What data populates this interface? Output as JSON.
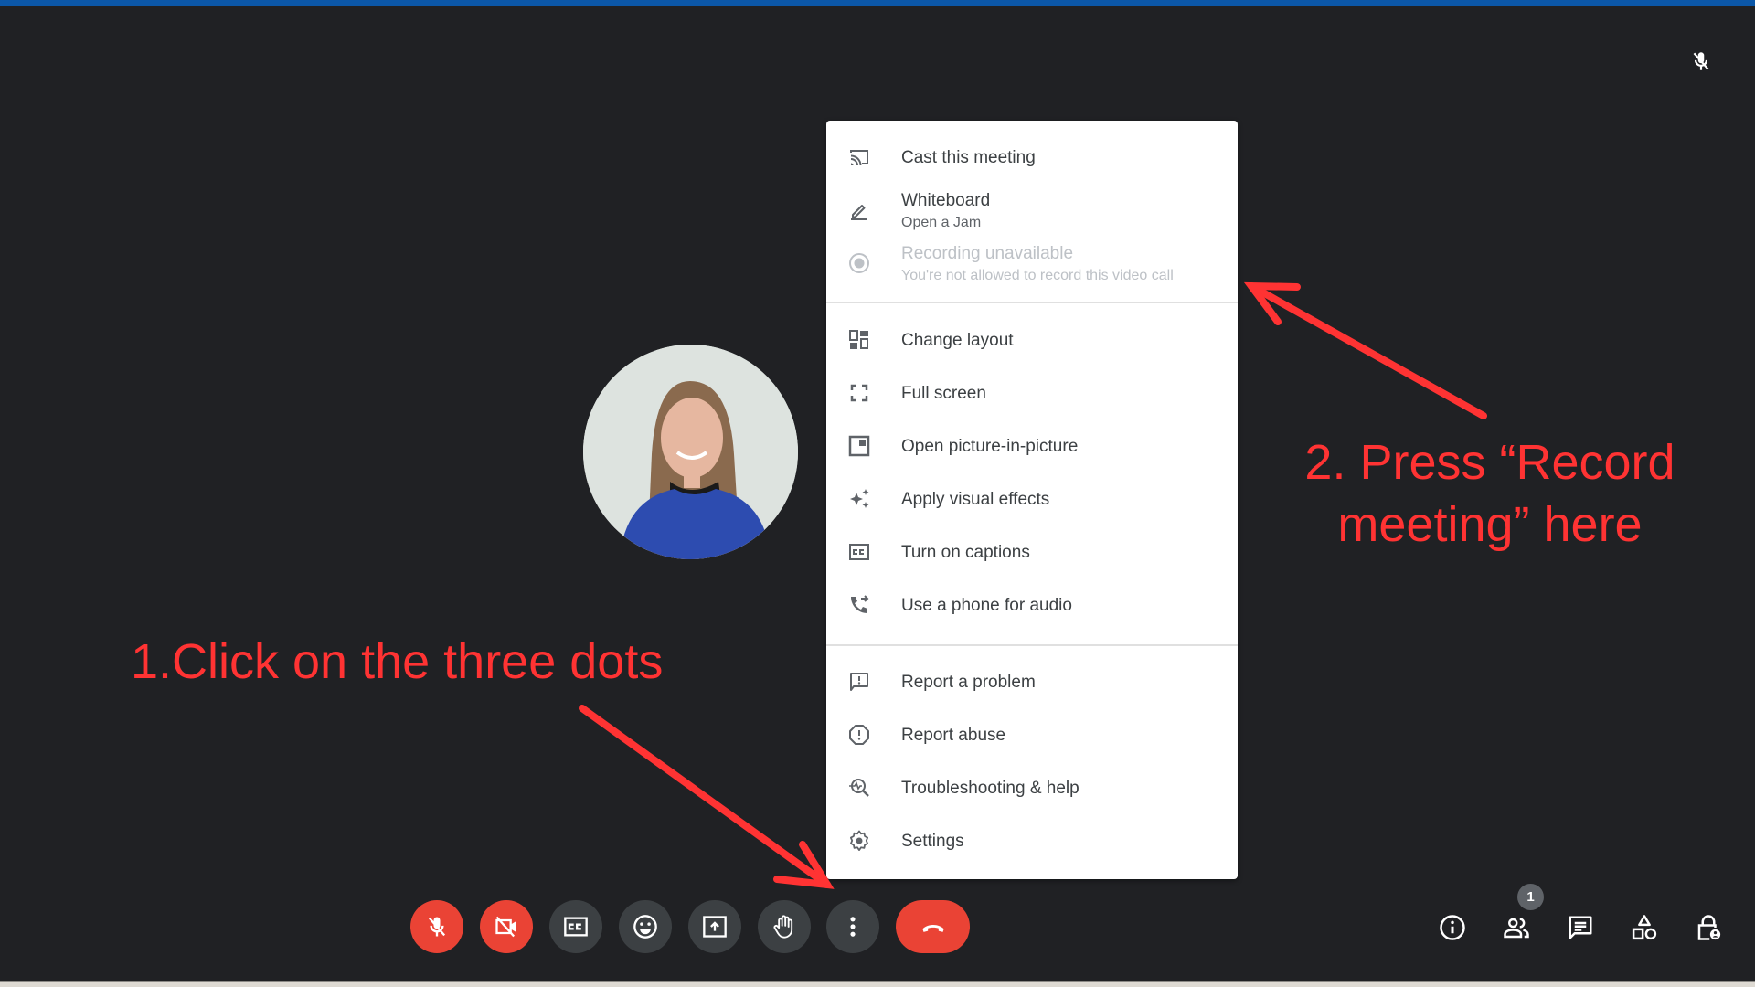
{
  "window": {
    "accent_color": "#0b57a8"
  },
  "colors": {
    "danger": "#ea4335",
    "button_bg": "#3c4043",
    "annotation": "#ff3333",
    "background": "#202124"
  },
  "participant": {
    "name_hidden": true,
    "mic_muted_icon": "mic-off-icon"
  },
  "more_options_menu": {
    "items": [
      {
        "label": "Cast this meeting",
        "icon": "cast-icon"
      },
      {
        "label": "Whiteboard",
        "sublabel": "Open a Jam",
        "icon": "pencil-icon"
      },
      {
        "label": "Recording unavailable",
        "sublabel": "You're not allowed to record this video call",
        "icon": "record-icon",
        "disabled": true
      },
      {
        "label": "Change layout",
        "icon": "layout-icon"
      },
      {
        "label": "Full screen",
        "icon": "fullscreen-icon"
      },
      {
        "label": "Open picture-in-picture",
        "icon": "pip-icon"
      },
      {
        "label": "Apply visual effects",
        "icon": "sparkle-icon"
      },
      {
        "label": "Turn on captions",
        "icon": "captions-icon"
      },
      {
        "label": "Use a phone for audio",
        "icon": "phone-forward-icon"
      },
      {
        "label": "Report a problem",
        "icon": "feedback-icon"
      },
      {
        "label": "Report abuse",
        "icon": "report-icon"
      },
      {
        "label": "Troubleshooting & help",
        "icon": "troubleshoot-icon"
      },
      {
        "label": "Settings",
        "icon": "gear-icon"
      }
    ]
  },
  "toolbar": {
    "buttons": [
      {
        "name": "microphone",
        "icon": "mic-off-icon",
        "state": "off"
      },
      {
        "name": "camera",
        "icon": "camera-off-icon",
        "state": "off"
      },
      {
        "name": "captions",
        "icon": "captions-icon"
      },
      {
        "name": "reactions",
        "icon": "emoji-icon"
      },
      {
        "name": "present",
        "icon": "present-screen-icon"
      },
      {
        "name": "raise-hand",
        "icon": "hand-icon"
      },
      {
        "name": "more-options",
        "icon": "more-vert-icon"
      },
      {
        "name": "leave-call",
        "icon": "hangup-icon"
      }
    ],
    "right": [
      {
        "name": "meeting-details",
        "icon": "info-icon"
      },
      {
        "name": "people",
        "icon": "people-icon",
        "badge": "1"
      },
      {
        "name": "chat",
        "icon": "chat-icon"
      },
      {
        "name": "activities",
        "icon": "shapes-icon"
      },
      {
        "name": "host-controls",
        "icon": "lock-person-icon"
      }
    ]
  },
  "annotations": {
    "step1": "1.Click on the three dots",
    "step2_line1": "2. Press “Record",
    "step2_line2": "meeting” here"
  }
}
